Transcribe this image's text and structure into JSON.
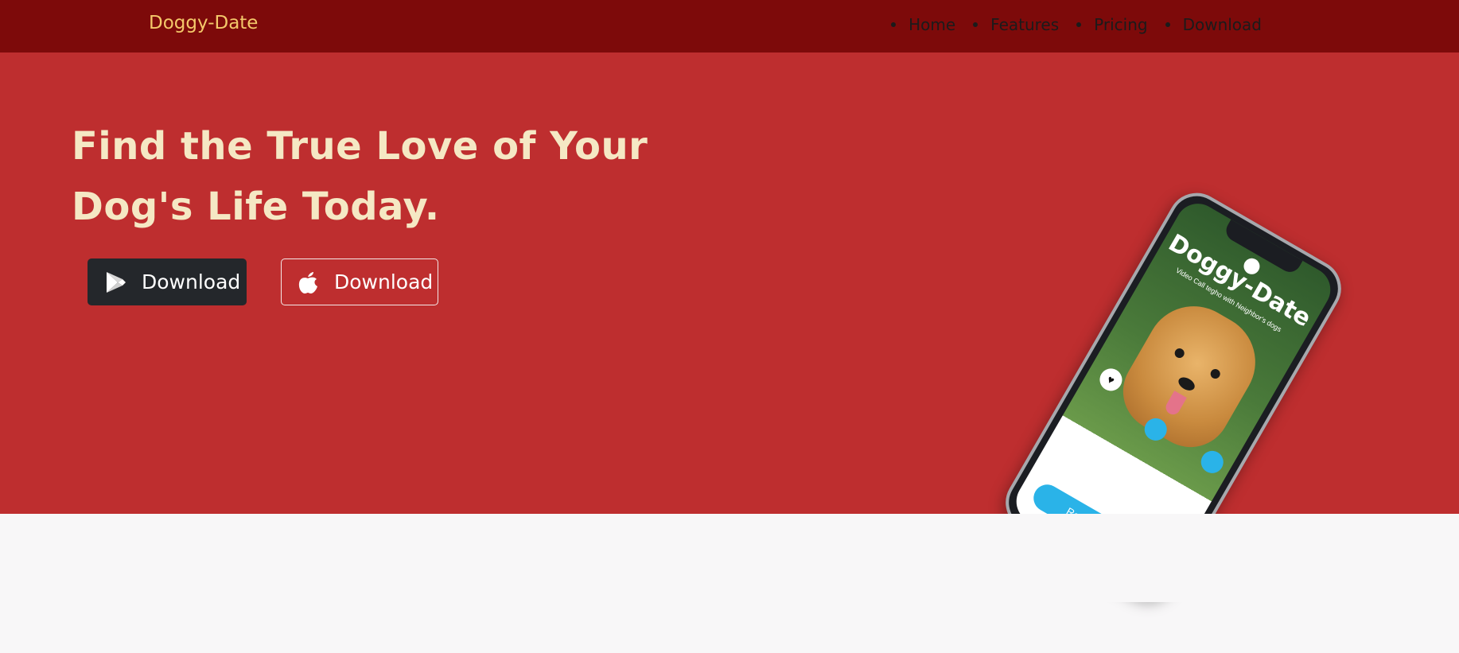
{
  "nav": {
    "brand": "Doggy-Date",
    "links": [
      "Home",
      "Features",
      "Pricing",
      "Download"
    ]
  },
  "hero": {
    "headline_line1": "Find the True Love of Your",
    "headline_line2": "Dog's Life Today.",
    "buttons": [
      {
        "label": "Download",
        "icon": "google-play-icon"
      },
      {
        "label": "Download",
        "icon": "apple-icon"
      }
    ]
  },
  "phone": {
    "app_title": "Doggy-Date",
    "app_subtitle": "Video Call tegho with Neighbor's dogs",
    "cta": "Renboogy Dog"
  },
  "colors": {
    "navbar": "#7d0a0a",
    "hero": "#be2e2f",
    "brand": "#f4c86a",
    "headline": "#f5e8c4",
    "dark_button": "#24272b"
  }
}
